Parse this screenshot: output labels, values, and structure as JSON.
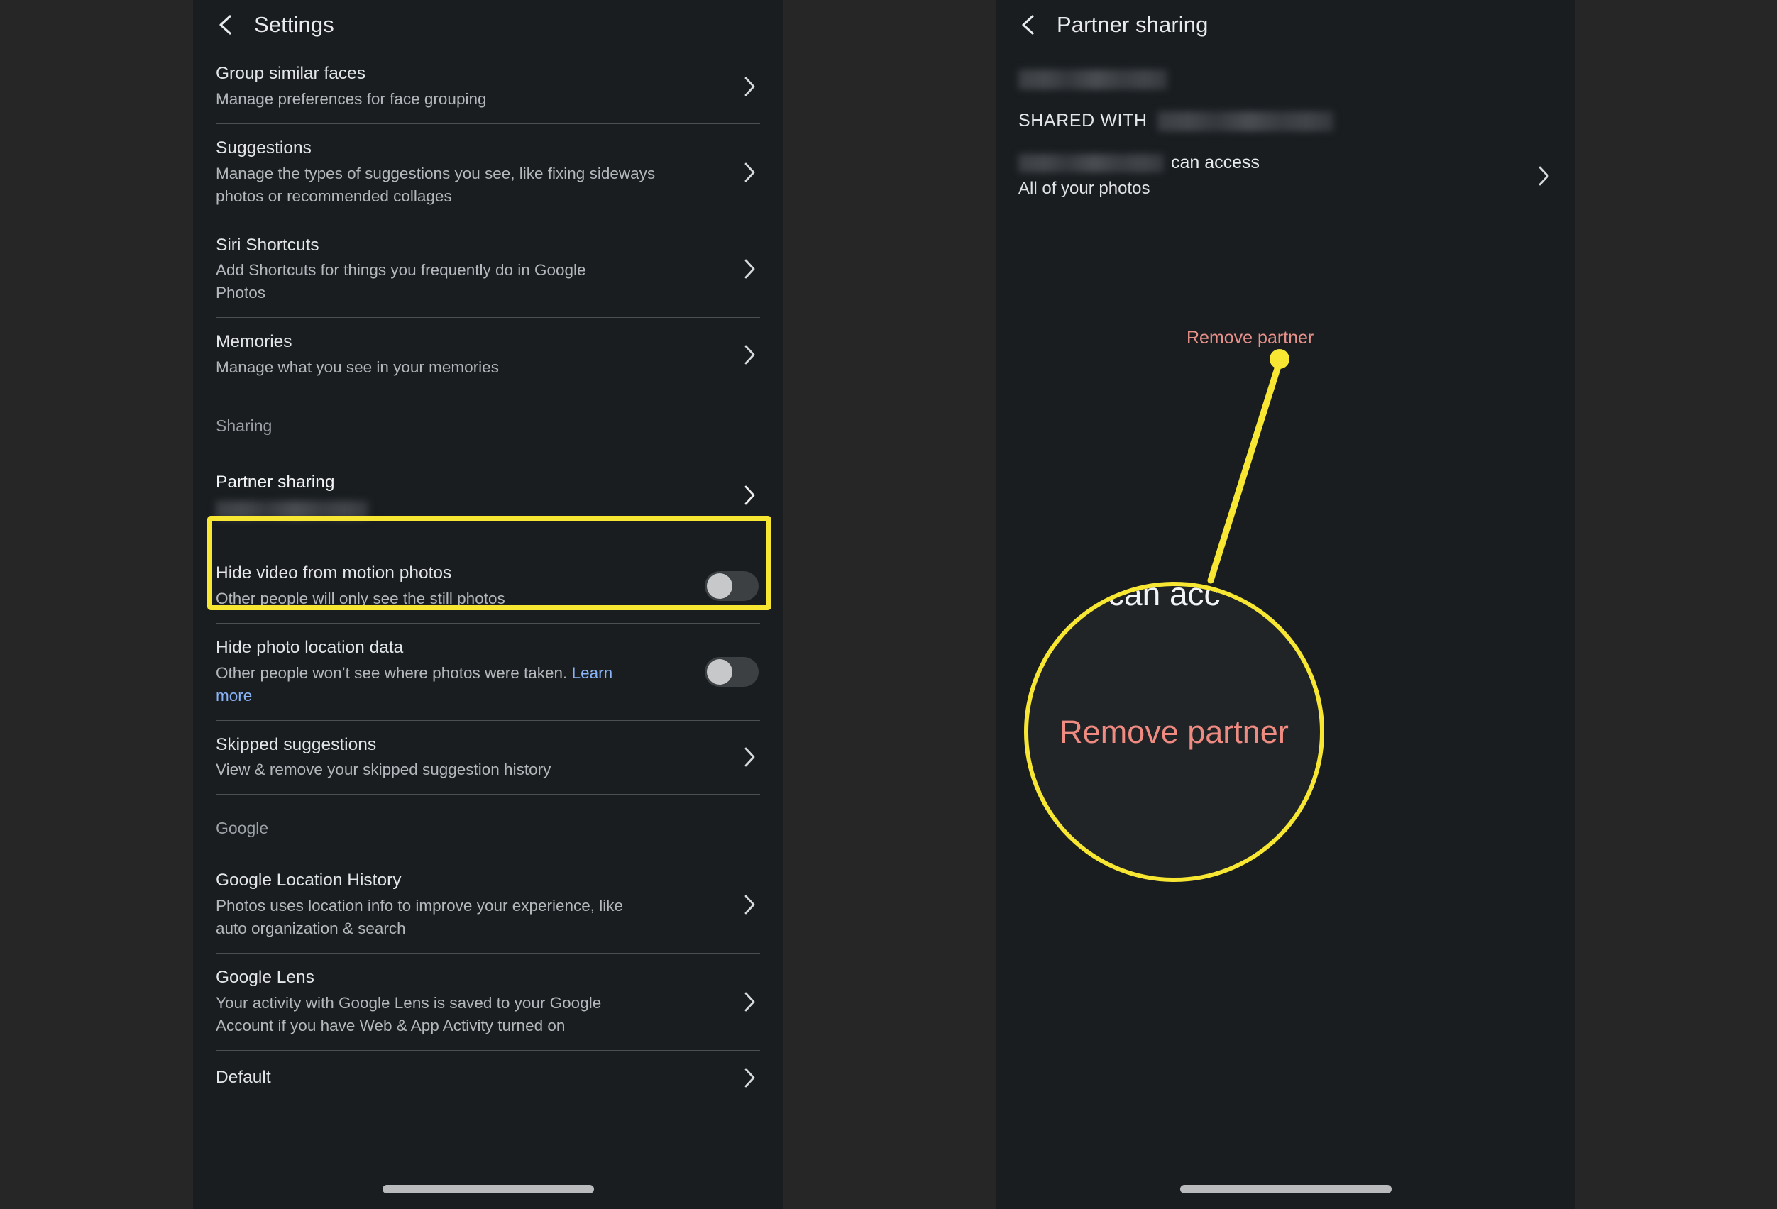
{
  "left_panel": {
    "header": {
      "back_icon": "back-chevron-icon",
      "title": "Settings"
    },
    "items": [
      {
        "title": "Group similar faces",
        "subtitle": "Manage preferences for face grouping",
        "control": "chevron"
      },
      {
        "title": "Suggestions",
        "subtitle": "Manage the types of suggestions you see, like fixing sideways photos or recommended collages",
        "control": "chevron"
      },
      {
        "title": "Siri Shortcuts",
        "subtitle": "Add Shortcuts for things you frequently do in Google Photos",
        "control": "chevron"
      },
      {
        "title": "Memories",
        "subtitle": "Manage what you see in your memories",
        "control": "chevron"
      }
    ],
    "sharing_section_label": "Sharing",
    "partner_sharing": {
      "title": "Partner sharing",
      "subtitle_redacted": true,
      "control": "chevron",
      "highlighted": true
    },
    "sharing_items": [
      {
        "title": "Hide video from motion photos",
        "subtitle": "Other people will only see the still photos",
        "control": "toggle",
        "toggle_on": false
      },
      {
        "title": "Hide photo location data",
        "subtitle": "Other people won’t see where photos were taken. ",
        "link_text": "Learn more",
        "control": "toggle",
        "toggle_on": false
      },
      {
        "title": "Skipped suggestions",
        "subtitle": "View & remove your skipped suggestion history",
        "control": "chevron"
      }
    ],
    "google_section_label": "Google",
    "google_items": [
      {
        "title": "Google Location History",
        "subtitle": "Photos uses location info to improve your experience, like auto organization & search",
        "control": "chevron"
      },
      {
        "title": "Google Lens",
        "subtitle": "Your activity with Google Lens is saved to your Google Account if you have Web & App Activity turned on",
        "control": "chevron"
      },
      {
        "title": "Default",
        "subtitle": "",
        "control": "chevron"
      }
    ]
  },
  "right_panel": {
    "header": {
      "back_icon": "back-chevron-icon",
      "title": "Partner sharing"
    },
    "shared_with_label": "SHARED WITH",
    "access_suffix": "can access",
    "access_detail": "All of your photos",
    "remove_partner_label": "Remove partner"
  },
  "annotation": {
    "callout_label": "Remove partner",
    "magnifier_fragment": "can acc",
    "magnifier_label": "Remove partner",
    "highlight_color": "#f7e733",
    "dot_color": "#f7e733",
    "remove_text_color": "#f08b82",
    "link_color": "#8ab4f8"
  }
}
